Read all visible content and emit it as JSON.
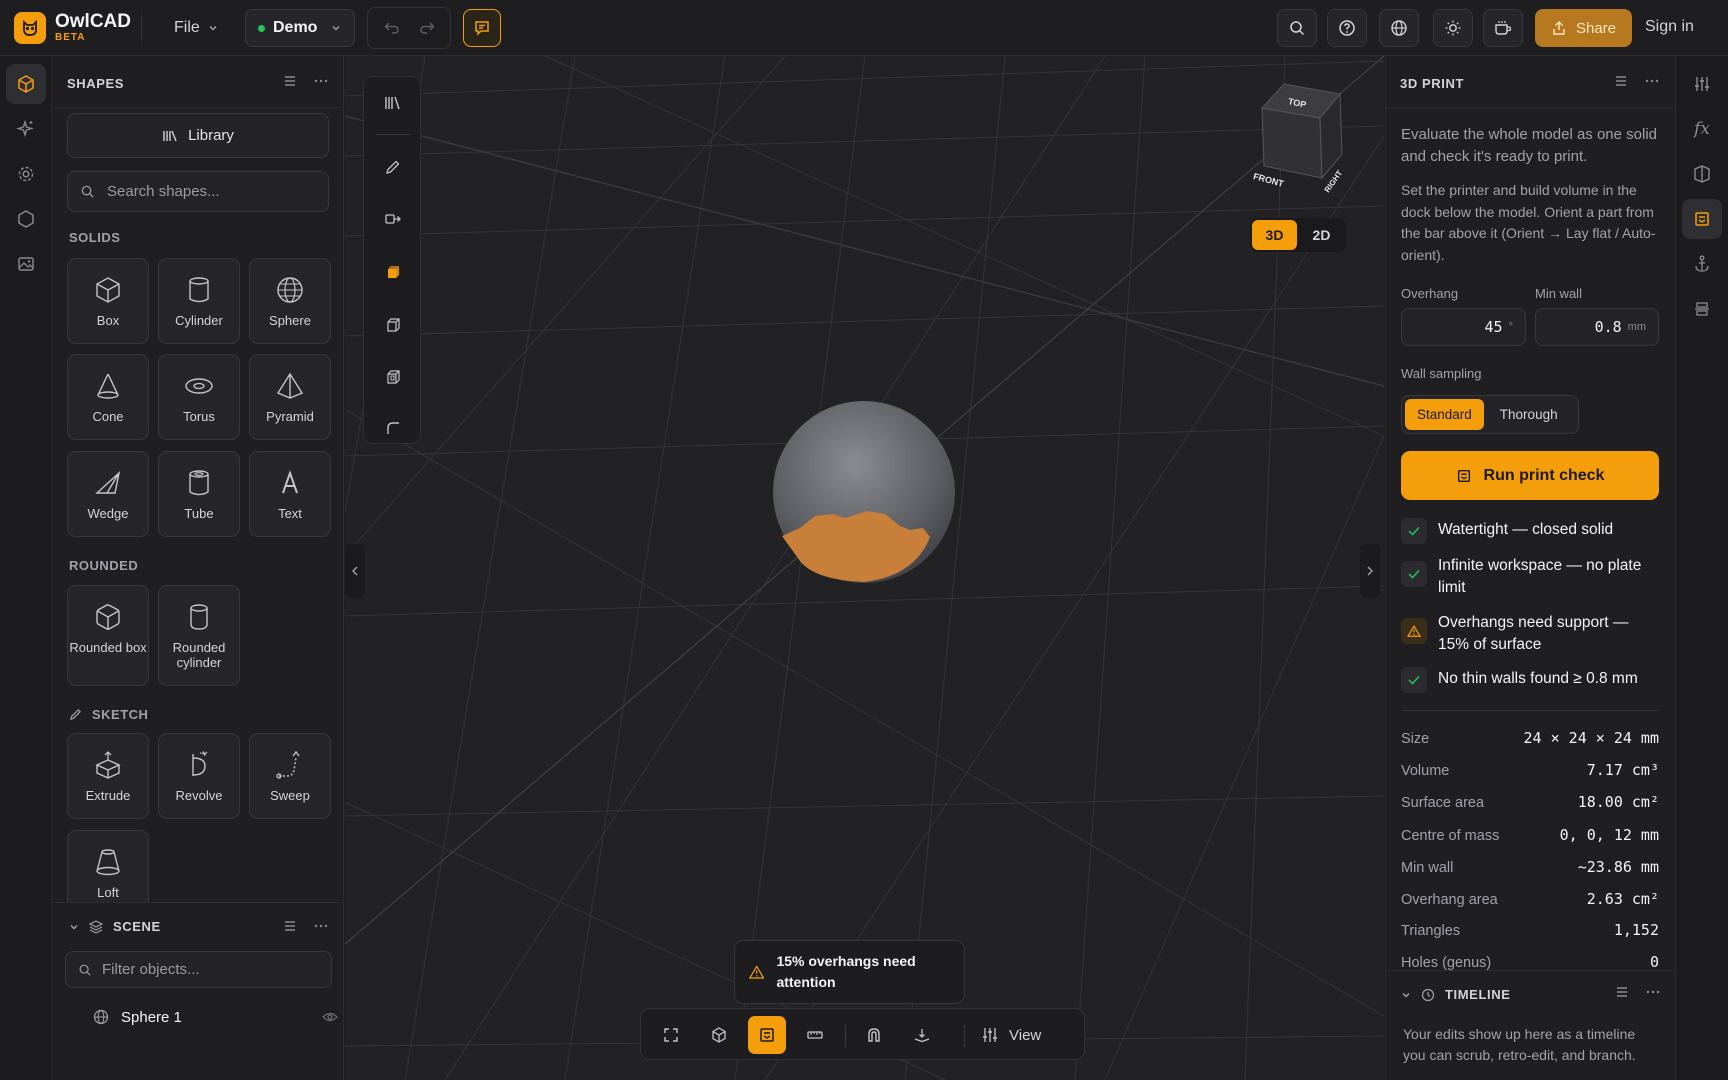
{
  "app": {
    "name": "OwlCAD",
    "badge": "BETA"
  },
  "menu": {
    "file": "File",
    "project": "Demo"
  },
  "topbar": {
    "share": "Share",
    "signin": "Sign in"
  },
  "shapes": {
    "title": "SHAPES",
    "library": "Library",
    "search_placeholder": "Search shapes...",
    "solids_label": "SOLIDS",
    "solids": [
      {
        "label": "Box",
        "icon": "box-icon"
      },
      {
        "label": "Cylinder",
        "icon": "cylinder-icon"
      },
      {
        "label": "Sphere",
        "icon": "sphere-icon"
      },
      {
        "label": "Cone",
        "icon": "cone-icon"
      },
      {
        "label": "Torus",
        "icon": "torus-icon"
      },
      {
        "label": "Pyramid",
        "icon": "pyramid-icon"
      },
      {
        "label": "Wedge",
        "icon": "wedge-icon"
      },
      {
        "label": "Tube",
        "icon": "tube-icon"
      },
      {
        "label": "Text",
        "icon": "text-icon"
      }
    ],
    "rounded_label": "ROUNDED",
    "rounded": [
      {
        "label": "Rounded box",
        "icon": "rounded-box-icon"
      },
      {
        "label": "Rounded cylinder",
        "icon": "rounded-cylinder-icon"
      }
    ],
    "sketch_label": "SKETCH",
    "sketch": [
      {
        "label": "Extrude",
        "icon": "extrude-icon"
      },
      {
        "label": "Revolve",
        "icon": "revolve-icon"
      },
      {
        "label": "Sweep",
        "icon": "sweep-icon"
      },
      {
        "label": "Loft",
        "icon": "loft-icon"
      }
    ]
  },
  "scene": {
    "title": "SCENE",
    "filter_placeholder": "Filter objects...",
    "objects": [
      {
        "name": "Sphere 1"
      }
    ]
  },
  "viewport": {
    "cube": {
      "top": "TOP",
      "front": "FRONT",
      "right": "RIGHT"
    },
    "mode_3d": "3D",
    "mode_2d": "2D",
    "active_mode": "3D",
    "toast": "15% overhangs need attention",
    "view_label": "View"
  },
  "print": {
    "title": "3D PRINT",
    "intro": "Evaluate the whole model as one solid and check it's ready to print.",
    "help": "Set the printer and build volume in the dock below the model. Orient a part from the bar above it (Orient → Lay flat / Auto-orient).",
    "overhang_label": "Overhang",
    "overhang_value": "45",
    "overhang_unit": "°",
    "minwall_label": "Min wall",
    "minwall_value": "0.8",
    "minwall_unit": "mm",
    "sampling_label": "Wall sampling",
    "sampling_options": [
      "Standard",
      "Thorough"
    ],
    "sampling_selected": "Standard",
    "run": "Run print check",
    "checks": [
      {
        "text": "Watertight — closed solid",
        "status": "pass"
      },
      {
        "text": "Infinite workspace — no plate limit",
        "status": "pass"
      },
      {
        "text": "Overhangs need support — 15% of surface",
        "status": "warn"
      },
      {
        "text": "No thin walls found ≥ 0.8 mm",
        "status": "pass"
      }
    ],
    "stats": [
      {
        "k": "Size",
        "v": "24 × 24 × 24 mm"
      },
      {
        "k": "Volume",
        "v": "7.17 cm³"
      },
      {
        "k": "Surface area",
        "v": "18.00 cm²"
      },
      {
        "k": "Centre of mass",
        "v": "0, 0, 12 mm"
      },
      {
        "k": "Min wall",
        "v": "~23.86 mm"
      },
      {
        "k": "Overhang area",
        "v": "2.63 cm²"
      },
      {
        "k": "Triangles",
        "v": "1,152"
      },
      {
        "k": "Holes (genus)",
        "v": "0"
      }
    ]
  },
  "timeline": {
    "title": "TIMELINE",
    "text": "Your edits show up here as a timeline you can scrub, retro-edit, and branch."
  },
  "colors": {
    "accent": "#f59e0b",
    "success": "#22c55e",
    "overhang": "#c87f3a"
  }
}
